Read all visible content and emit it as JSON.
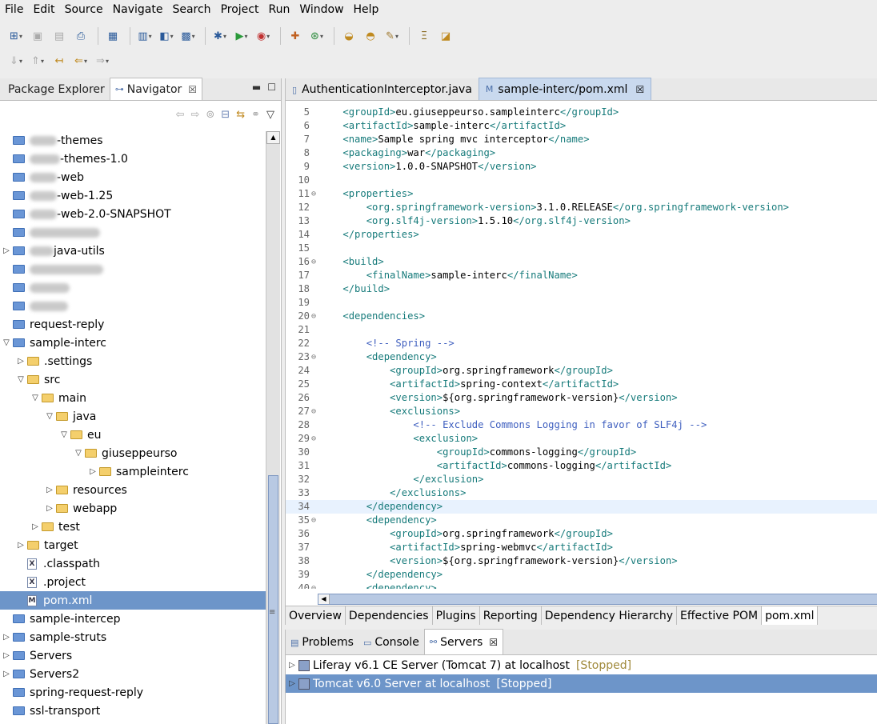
{
  "menu": [
    "File",
    "Edit",
    "Source",
    "Navigate",
    "Search",
    "Project",
    "Run",
    "Window",
    "Help"
  ],
  "toolbar_icons": [
    "new-wizard-icon",
    "save-icon",
    "save-all-icon",
    "print-icon",
    "binary-icon",
    "new-server-icon",
    "open-type-icon",
    "open-perspective-icon",
    "debug-icon",
    "run-icon",
    "stop-icon",
    "external-tools-icon",
    "coverage-icon",
    "open-folder-icon",
    "open-file-icon",
    "pen-icon",
    "format-icon",
    "task-icon"
  ],
  "left_tabs": {
    "package_explorer": "Package Explorer",
    "navigator": "Navigator"
  },
  "tree": [
    {
      "label": "-themes",
      "indent": 0,
      "arrow": "",
      "icon": "blue",
      "blur": true
    },
    {
      "label": "-themes-1.0",
      "indent": 0,
      "arrow": "",
      "icon": "blue",
      "blur": true
    },
    {
      "label": "-web",
      "indent": 0,
      "arrow": "",
      "icon": "blue",
      "blur": true
    },
    {
      "label": "-web-1.25",
      "indent": 0,
      "arrow": "",
      "icon": "blue",
      "blur": true
    },
    {
      "label": "-web-2.0-SNAPSHOT",
      "indent": 0,
      "arrow": "",
      "icon": "blue",
      "blur": true
    },
    {
      "label": "",
      "indent": 0,
      "arrow": "",
      "icon": "blue",
      "blur": true
    },
    {
      "label": "java-utils",
      "indent": 0,
      "arrow": "▷",
      "icon": "blue",
      "blur": true
    },
    {
      "label": "",
      "indent": 0,
      "arrow": "",
      "icon": "blue",
      "blur": true
    },
    {
      "label": "",
      "indent": 0,
      "arrow": "",
      "icon": "blue",
      "blur": true
    },
    {
      "label": "",
      "indent": 0,
      "arrow": "",
      "icon": "blue",
      "blur": true
    },
    {
      "label": "request-reply",
      "indent": 0,
      "arrow": "",
      "icon": "blue"
    },
    {
      "label": "sample-interc",
      "indent": 0,
      "arrow": "▽",
      "icon": "proj"
    },
    {
      "label": ".settings",
      "indent": 1,
      "arrow": "▷",
      "icon": "yellow"
    },
    {
      "label": "src",
      "indent": 1,
      "arrow": "▽",
      "icon": "yellow"
    },
    {
      "label": "main",
      "indent": 2,
      "arrow": "▽",
      "icon": "yellow"
    },
    {
      "label": "java",
      "indent": 3,
      "arrow": "▽",
      "icon": "yellow"
    },
    {
      "label": "eu",
      "indent": 4,
      "arrow": "▽",
      "icon": "yellow"
    },
    {
      "label": "giuseppeurso",
      "indent": 5,
      "arrow": "▽",
      "icon": "yellow"
    },
    {
      "label": "sampleinterc",
      "indent": 6,
      "arrow": "▷",
      "icon": "yellow"
    },
    {
      "label": "resources",
      "indent": 3,
      "arrow": "▷",
      "icon": "yellow"
    },
    {
      "label": "webapp",
      "indent": 3,
      "arrow": "▷",
      "icon": "yellow"
    },
    {
      "label": "test",
      "indent": 2,
      "arrow": "▷",
      "icon": "yellow"
    },
    {
      "label": "target",
      "indent": 1,
      "arrow": "▷",
      "icon": "yellow"
    },
    {
      "label": ".classpath",
      "indent": 1,
      "arrow": "",
      "icon": "file"
    },
    {
      "label": ".project",
      "indent": 1,
      "arrow": "",
      "icon": "file"
    },
    {
      "label": "pom.xml",
      "indent": 1,
      "arrow": "",
      "icon": "pom",
      "selected": true
    },
    {
      "label": "sample-intercep",
      "indent": 0,
      "arrow": "",
      "icon": "blue"
    },
    {
      "label": "sample-struts",
      "indent": 0,
      "arrow": "▷",
      "icon": "proj"
    },
    {
      "label": "Servers",
      "indent": 0,
      "arrow": "▷",
      "icon": "blue"
    },
    {
      "label": "Servers2",
      "indent": 0,
      "arrow": "▷",
      "icon": "blue"
    },
    {
      "label": "spring-request-reply",
      "indent": 0,
      "arrow": "",
      "icon": "blue"
    },
    {
      "label": "ssl-transport",
      "indent": 0,
      "arrow": "",
      "icon": "blue"
    }
  ],
  "editor_tabs": {
    "tab1": "AuthenticationInterceptor.java",
    "tab2": "sample-interc/pom.xml"
  },
  "code": [
    {
      "n": "5",
      "fold": "",
      "text": "    <groupId>eu.giuseppeurso.sampleinterc</groupId>"
    },
    {
      "n": "6",
      "fold": "",
      "text": "    <artifactId>sample-interc</artifactId>"
    },
    {
      "n": "7",
      "fold": "",
      "text": "    <name>Sample spring mvc interceptor</name>"
    },
    {
      "n": "8",
      "fold": "",
      "text": "    <packaging>war</packaging>"
    },
    {
      "n": "9",
      "fold": "",
      "text": "    <version>1.0.0-SNAPSHOT</version>"
    },
    {
      "n": "10",
      "fold": "",
      "text": ""
    },
    {
      "n": "11",
      "fold": "⊖",
      "text": "    <properties>"
    },
    {
      "n": "12",
      "fold": "",
      "text": "        <org.springframework-version>3.1.0.RELEASE</org.springframework-version>"
    },
    {
      "n": "13",
      "fold": "",
      "text": "        <org.slf4j-version>1.5.10</org.slf4j-version>"
    },
    {
      "n": "14",
      "fold": "",
      "text": "    </properties>"
    },
    {
      "n": "15",
      "fold": "",
      "text": ""
    },
    {
      "n": "16",
      "fold": "⊖",
      "text": "    <build>"
    },
    {
      "n": "17",
      "fold": "",
      "text": "        <finalName>sample-interc</finalName>"
    },
    {
      "n": "18",
      "fold": "",
      "text": "    </build>"
    },
    {
      "n": "19",
      "fold": "",
      "text": ""
    },
    {
      "n": "20",
      "fold": "⊖",
      "text": "    <dependencies>"
    },
    {
      "n": "21",
      "fold": "",
      "text": ""
    },
    {
      "n": "22",
      "fold": "",
      "text": "        <!-- Spring -->"
    },
    {
      "n": "23",
      "fold": "⊖",
      "text": "        <dependency>"
    },
    {
      "n": "24",
      "fold": "",
      "text": "            <groupId>org.springframework</groupId>"
    },
    {
      "n": "25",
      "fold": "",
      "text": "            <artifactId>spring-context</artifactId>"
    },
    {
      "n": "26",
      "fold": "",
      "text": "            <version>${org.springframework-version}</version>"
    },
    {
      "n": "27",
      "fold": "⊖",
      "text": "            <exclusions>"
    },
    {
      "n": "28",
      "fold": "",
      "text": "                <!-- Exclude Commons Logging in favor of SLF4j -->"
    },
    {
      "n": "29",
      "fold": "⊖",
      "text": "                <exclusion>"
    },
    {
      "n": "30",
      "fold": "",
      "text": "                    <groupId>commons-logging</groupId>"
    },
    {
      "n": "31",
      "fold": "",
      "text": "                    <artifactId>commons-logging</artifactId>"
    },
    {
      "n": "32",
      "fold": "",
      "text": "                </exclusion>"
    },
    {
      "n": "33",
      "fold": "",
      "text": "            </exclusions>"
    },
    {
      "n": "34",
      "fold": "",
      "text": "        </dependency>",
      "current": true
    },
    {
      "n": "35",
      "fold": "⊖",
      "text": "        <dependency>"
    },
    {
      "n": "36",
      "fold": "",
      "text": "            <groupId>org.springframework</groupId>"
    },
    {
      "n": "37",
      "fold": "",
      "text": "            <artifactId>spring-webmvc</artifactId>"
    },
    {
      "n": "38",
      "fold": "",
      "text": "            <version>${org.springframework-version}</version>"
    },
    {
      "n": "39",
      "fold": "",
      "text": "        </dependency>"
    },
    {
      "n": "40",
      "fold": "⊖",
      "text": "        <dependency>"
    }
  ],
  "pom_tabs": [
    "Overview",
    "Dependencies",
    "Plugins",
    "Reporting",
    "Dependency Hierarchy",
    "Effective POM",
    "pom.xml"
  ],
  "pom_tabs_active": "pom.xml",
  "bottom_tabs": {
    "problems": "Problems",
    "console": "Console",
    "servers": "Servers"
  },
  "servers": [
    {
      "name": "Liferay v6.1 CE Server (Tomcat 7) at localhost",
      "status": "[Stopped]"
    },
    {
      "name": "Tomcat v6.0 Server at localhost",
      "status": "[Stopped]"
    }
  ],
  "colors": {
    "selection": "#6d95c9",
    "xml_tag": "#177b7b",
    "comment": "#3f5fbf",
    "folder_blue": "#6a96d6",
    "folder_yellow": "#f4cf6c"
  }
}
